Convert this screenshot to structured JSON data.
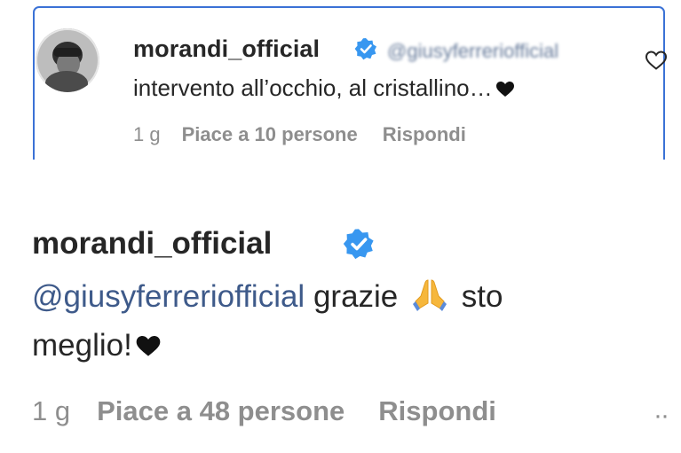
{
  "highlighted_comment": {
    "username": "morandi_official",
    "mention_redacted": "@giusyferreriofficial",
    "text": "intervento all’occhio, al cristallino…",
    "time": "1 g",
    "likes": "Piace a 10 persone",
    "reply_label": "Rispondi"
  },
  "reply_comment": {
    "username": "morandi_official",
    "mention": "@giusyferreriofficial",
    "text_after_mention": " grazie ",
    "text_after_emoji": " sto",
    "line2": "meglio!",
    "time": "1 g",
    "likes": "Piace a 48 persone",
    "reply_label": "Rispondi",
    "more": "··"
  },
  "colors": {
    "card_border": "#3b72d6",
    "verified_badge": "#3897f0",
    "mention": "#3e5a8a",
    "meta_gray": "#8e8e8e"
  },
  "icons": {
    "verified": "verified-badge-icon",
    "heart": "black-heart-icon",
    "like": "heart-outline-icon",
    "pray": "folded-hands-emoji"
  }
}
